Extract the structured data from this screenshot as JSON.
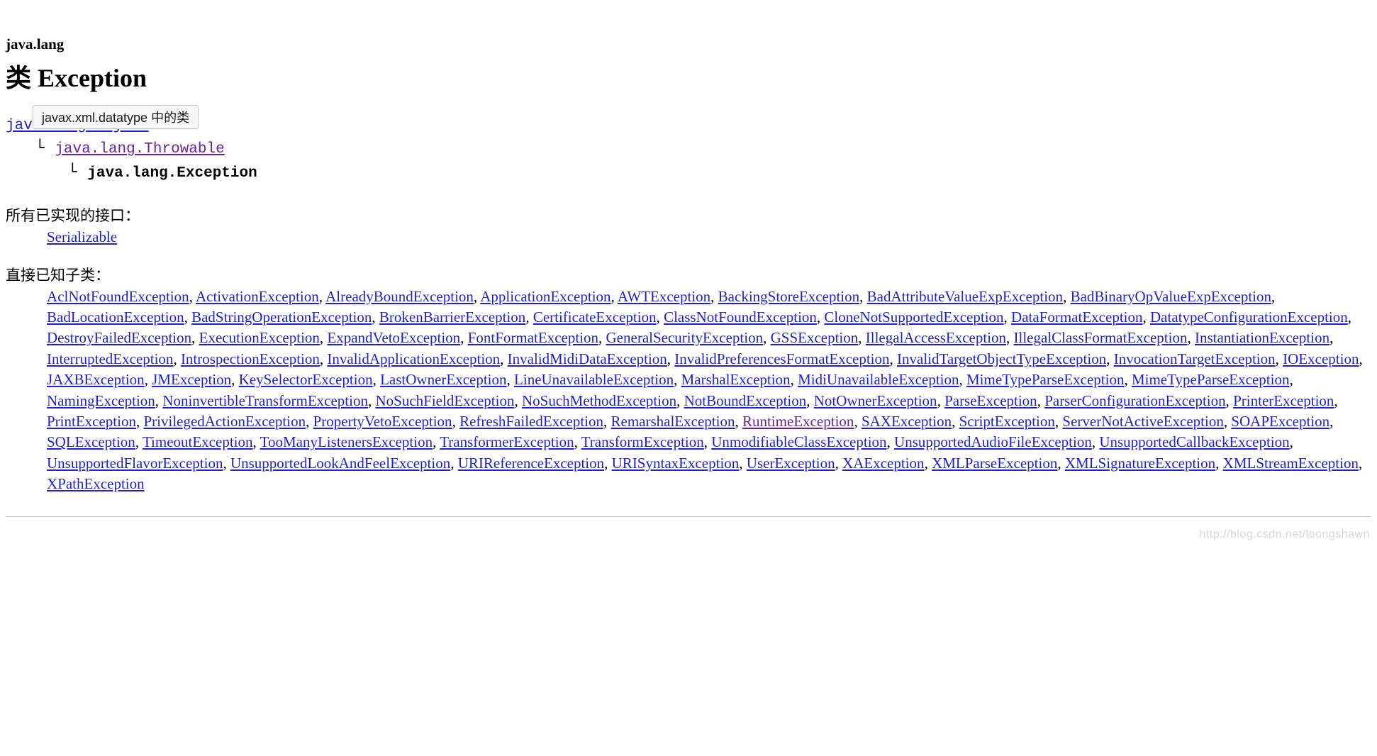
{
  "package": "java.lang",
  "title": "类 Exception",
  "tooltip": "javax.xml.datatype 中的类",
  "inheritance": {
    "level0": "java.lang.Object",
    "level1": "java.lang.Throwable",
    "level2": "java.lang.Exception"
  },
  "interfaces_heading": "所有已实现的接口：",
  "interfaces": [
    "Serializable"
  ],
  "subclasses_heading": "直接已知子类：",
  "subclasses": [
    {
      "t": "AclNotFoundException"
    },
    {
      "t": "ActivationException"
    },
    {
      "t": "AlreadyBoundException"
    },
    {
      "t": "ApplicationException"
    },
    {
      "t": "AWTException"
    },
    {
      "t": "BackingStoreException"
    },
    {
      "t": "BadAttributeValueExpException"
    },
    {
      "t": "BadBinaryOpValueExpException"
    },
    {
      "t": "BadLocationException"
    },
    {
      "t": "BadStringOperationException"
    },
    {
      "t": "BrokenBarrierException"
    },
    {
      "t": "CertificateException"
    },
    {
      "t": "ClassNotFoundException"
    },
    {
      "t": "CloneNotSupportedException"
    },
    {
      "t": "DataFormatException"
    },
    {
      "t": "DatatypeConfigurationException"
    },
    {
      "t": "DestroyFailedException"
    },
    {
      "t": "ExecutionException"
    },
    {
      "t": "ExpandVetoException"
    },
    {
      "t": "FontFormatException"
    },
    {
      "t": "GeneralSecurityException"
    },
    {
      "t": "GSSException"
    },
    {
      "t": "IllegalAccessException"
    },
    {
      "t": "IllegalClassFormatException"
    },
    {
      "t": "InstantiationException"
    },
    {
      "t": "InterruptedException"
    },
    {
      "t": "IntrospectionException"
    },
    {
      "t": "InvalidApplicationException"
    },
    {
      "t": "InvalidMidiDataException"
    },
    {
      "t": "InvalidPreferencesFormatException"
    },
    {
      "t": "InvalidTargetObjectTypeException"
    },
    {
      "t": "InvocationTargetException"
    },
    {
      "t": "IOException"
    },
    {
      "t": "JAXBException"
    },
    {
      "t": "JMException"
    },
    {
      "t": "KeySelectorException"
    },
    {
      "t": "LastOwnerException"
    },
    {
      "t": "LineUnavailableException"
    },
    {
      "t": "MarshalException"
    },
    {
      "t": "MidiUnavailableException"
    },
    {
      "t": "MimeTypeParseException"
    },
    {
      "t": "MimeTypeParseException"
    },
    {
      "t": "NamingException"
    },
    {
      "t": "NoninvertibleTransformException"
    },
    {
      "t": "NoSuchFieldException"
    },
    {
      "t": "NoSuchMethodException"
    },
    {
      "t": "NotBoundException"
    },
    {
      "t": "NotOwnerException"
    },
    {
      "t": "ParseException"
    },
    {
      "t": "ParserConfigurationException"
    },
    {
      "t": "PrinterException"
    },
    {
      "t": "PrintException"
    },
    {
      "t": "PrivilegedActionException"
    },
    {
      "t": "PropertyVetoException"
    },
    {
      "t": "RefreshFailedException"
    },
    {
      "t": "RemarshalException"
    },
    {
      "t": "RuntimeException",
      "visited": true
    },
    {
      "t": "SAXException"
    },
    {
      "t": "ScriptException"
    },
    {
      "t": "ServerNotActiveException"
    },
    {
      "t": "SOAPException"
    },
    {
      "t": "SQLException"
    },
    {
      "t": "TimeoutException"
    },
    {
      "t": "TooManyListenersException"
    },
    {
      "t": "TransformerException"
    },
    {
      "t": "TransformException"
    },
    {
      "t": "UnmodifiableClassException"
    },
    {
      "t": "UnsupportedAudioFileException"
    },
    {
      "t": "UnsupportedCallbackException"
    },
    {
      "t": "UnsupportedFlavorException"
    },
    {
      "t": "UnsupportedLookAndFeelException"
    },
    {
      "t": "URIReferenceException"
    },
    {
      "t": "URISyntaxException"
    },
    {
      "t": "UserException"
    },
    {
      "t": "XAException"
    },
    {
      "t": "XMLParseException"
    },
    {
      "t": "XMLSignatureException"
    },
    {
      "t": "XMLStreamException"
    },
    {
      "t": "XPathException"
    }
  ],
  "watermark": "http://blog.csdn.net/loongshawn"
}
